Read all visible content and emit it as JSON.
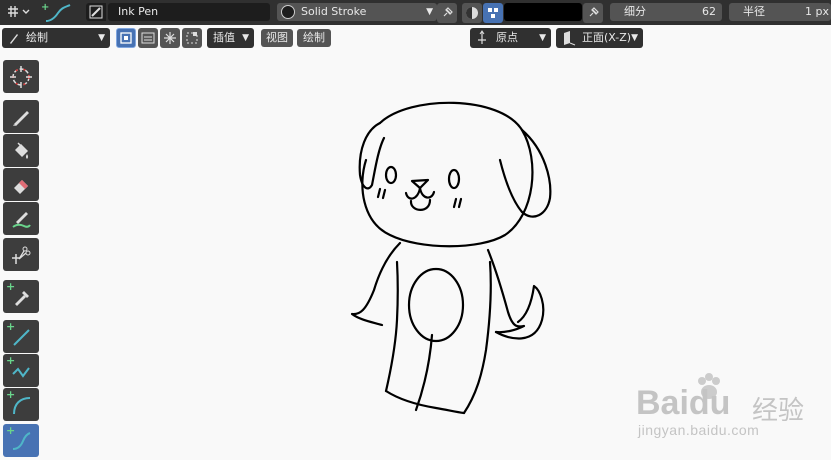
{
  "topbar": {
    "brush_name": "Ink Pen",
    "material_name": "Solid Stroke",
    "subdivide": {
      "label": "细分",
      "value": "62"
    },
    "radius": {
      "label": "半径",
      "value": "1 px"
    },
    "color_swatch": "#000000"
  },
  "subbar": {
    "mode_label": "绘制",
    "interp_label": "插值",
    "view_label": "视图",
    "draw_label": "绘制",
    "origin_label": "原点",
    "plane_label": "正面(X-Z)"
  },
  "toolbar": {
    "tools": [
      {
        "name": "cursor-tool",
        "icon": "cursor-icon"
      },
      {
        "name": "draw-tool",
        "icon": "pencil-icon"
      },
      {
        "name": "fill-tool",
        "icon": "bucket-icon"
      },
      {
        "name": "erase-tool",
        "icon": "eraser-icon"
      },
      {
        "name": "tint-tool",
        "icon": "brush-icon"
      },
      {
        "name": "cutter-tool",
        "icon": "scissors-icon"
      },
      {
        "name": "eyedropper-tool",
        "icon": "eyedropper-icon"
      },
      {
        "name": "line-tool",
        "icon": "line-icon"
      },
      {
        "name": "polyline-tool",
        "icon": "polyline-icon"
      },
      {
        "name": "arc-tool",
        "icon": "arc-icon"
      },
      {
        "name": "curve-tool",
        "icon": "curve-icon"
      }
    ]
  },
  "watermark": {
    "brand": "Baidu",
    "brand_cn": "经验",
    "url": "jingyan.baidu.com"
  },
  "colors": {
    "header_bg": "#303030",
    "field_bg": "#1d1d1d",
    "accent": "#4772b3",
    "canvas_bg": "#f9f9f9",
    "stroke": "#000000"
  }
}
